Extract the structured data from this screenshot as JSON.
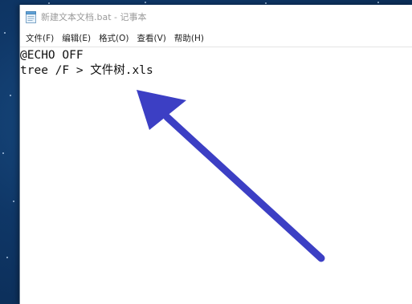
{
  "window": {
    "title": "新建文本文档.bat - 记事本"
  },
  "menu": [
    {
      "label": "文件(F)"
    },
    {
      "label": "编辑(E)"
    },
    {
      "label": "格式(O)"
    },
    {
      "label": "查看(V)"
    },
    {
      "label": "帮助(H)"
    }
  ],
  "editor": {
    "lines": [
      "@ECHO OFF",
      "tree /F > 文件树.xls"
    ]
  },
  "colors": {
    "annotation_arrow": "#3c3fc4",
    "desktop_background": "#0f3767"
  },
  "icons": [
    "notepad-icon",
    "annotation-arrow"
  ]
}
